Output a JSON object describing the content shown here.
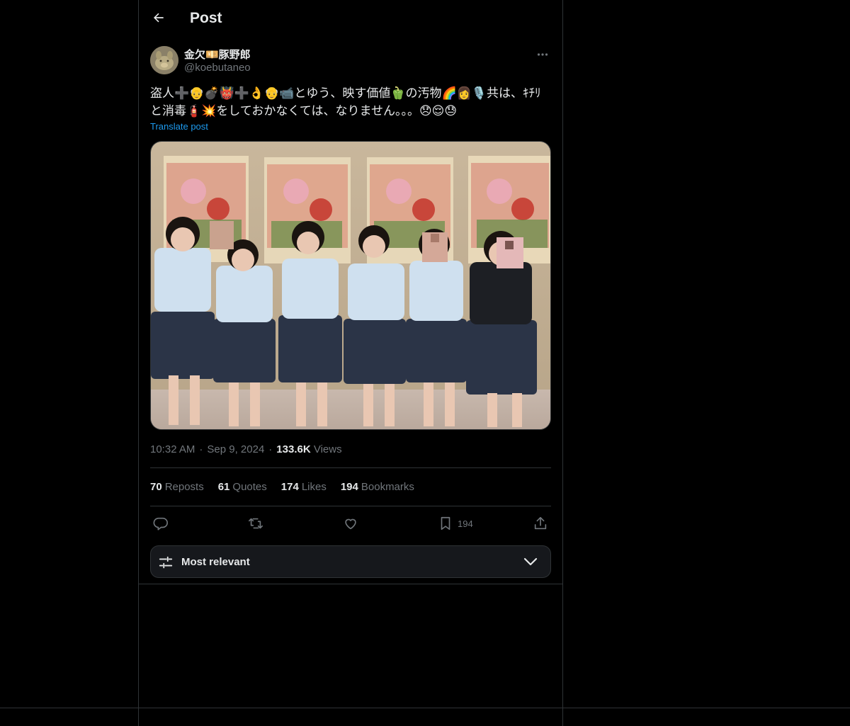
{
  "header": {
    "title": "Post",
    "back_icon": "arrow-left-icon"
  },
  "post": {
    "author": {
      "display_name": "金欠💴豚野郎",
      "handle": "@koebutaneo",
      "avatar_icon": "pig-avatar"
    },
    "text": "盗人➕👴💣👹➕👌👴📹とゆう、映す価値🫑の汚物🌈👩🎙️共は、ｷﾁﾘと消毒🧯💥をしておかなくては、なりません。。。😞😌😓",
    "translate_label": "Translate post",
    "media": {
      "type": "photo",
      "description_icon": "group-photo"
    },
    "time": "10:32 AM",
    "date": "Sep 9, 2024",
    "views_count": "133.6K",
    "views_label": "Views",
    "stats": {
      "reposts": {
        "count": "70",
        "label": "Reposts"
      },
      "quotes": {
        "count": "61",
        "label": "Quotes"
      },
      "likes": {
        "count": "174",
        "label": "Likes"
      },
      "bookmarks": {
        "count": "194",
        "label": "Bookmarks"
      }
    },
    "actions": {
      "reply_icon": "reply-icon",
      "repost_icon": "repost-icon",
      "like_icon": "heart-icon",
      "bookmark_icon": "bookmark-icon",
      "bookmark_count": "194",
      "share_icon": "share-icon"
    }
  },
  "replies_sort": {
    "label": "Most relevant"
  },
  "colors": {
    "background": "#000000",
    "text": "#e7e9ea",
    "muted": "#71767b",
    "accent": "#1d9bf0",
    "border": "#2f3336"
  }
}
